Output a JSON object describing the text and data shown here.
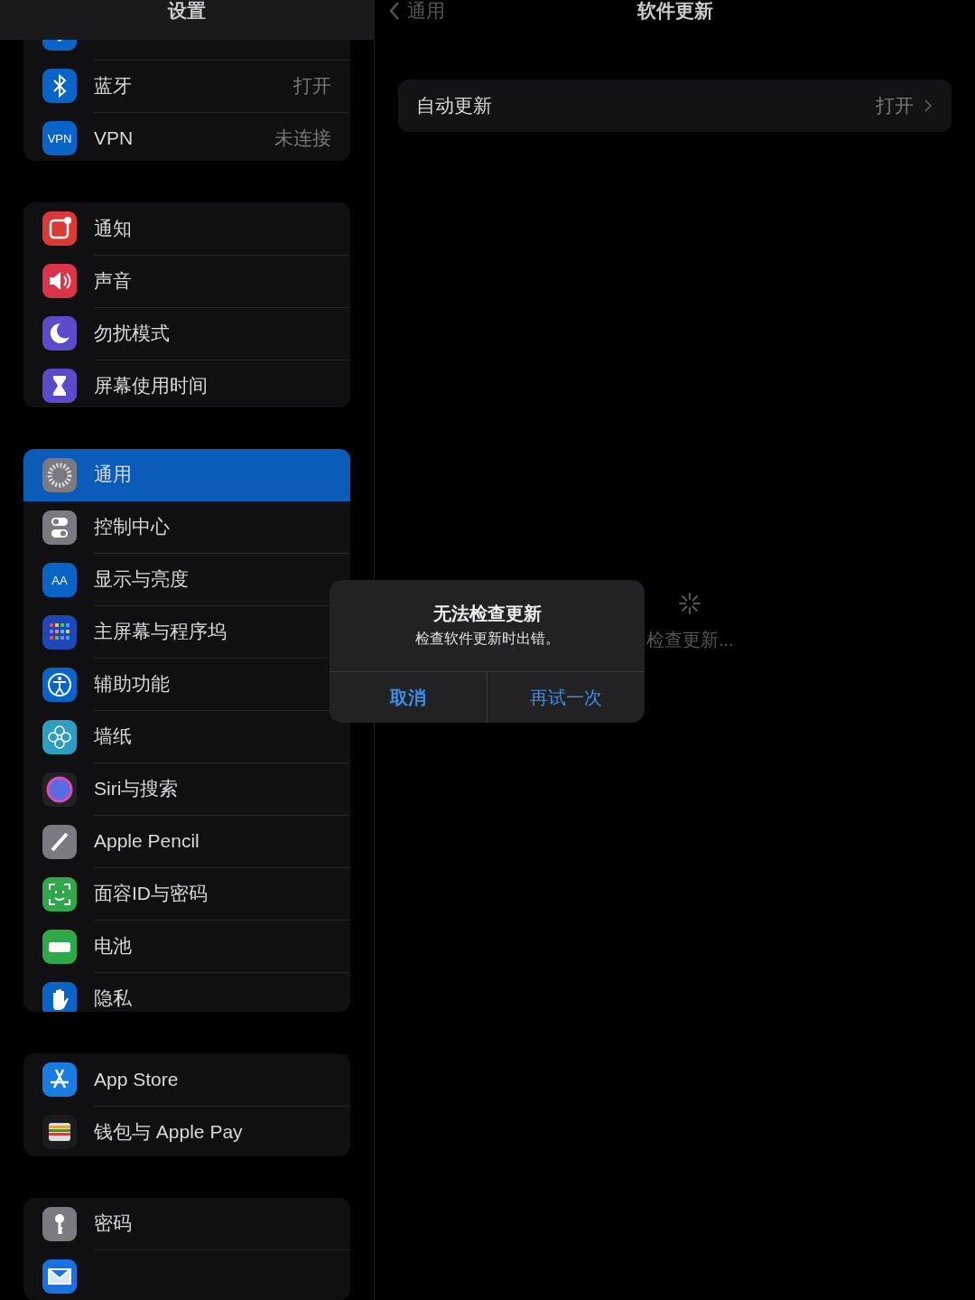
{
  "sidebar": {
    "title": "设置",
    "groups": [
      {
        "items": [
          {
            "kind": "wifi",
            "selected": false
          },
          {
            "kind": "bluetooth",
            "label": "蓝牙",
            "value": "打开",
            "selected": false
          },
          {
            "kind": "vpn",
            "icon_text": "VPN",
            "label": "VPN",
            "value": "未连接",
            "selected": false
          }
        ]
      },
      {
        "items": [
          {
            "kind": "notifications",
            "label": "通知",
            "selected": false
          },
          {
            "kind": "sound",
            "label": "声音",
            "selected": false
          },
          {
            "kind": "moon",
            "label": "勿扰模式",
            "selected": false
          },
          {
            "kind": "hourglass",
            "label": "屏幕使用时间",
            "selected": false
          }
        ]
      },
      {
        "items": [
          {
            "kind": "gear",
            "label": "通用",
            "selected": true
          },
          {
            "kind": "toggles",
            "label": "控制中心",
            "selected": false
          },
          {
            "kind": "text",
            "icon_text": "AA",
            "label": "显示与亮度",
            "selected": false
          },
          {
            "kind": "grid",
            "label": "主屏幕与程序坞",
            "selected": false
          },
          {
            "kind": "accessibility",
            "label": "辅助功能",
            "selected": false
          },
          {
            "kind": "flower",
            "label": "墙纸",
            "selected": false
          },
          {
            "kind": "orb",
            "label": "Siri与搜索",
            "selected": false
          },
          {
            "kind": "pencil",
            "label": "Apple Pencil",
            "selected": false
          },
          {
            "kind": "face",
            "label": "面容ID与密码",
            "selected": false
          },
          {
            "kind": "battery",
            "label": "电池",
            "selected": false
          },
          {
            "kind": "hand",
            "label": "隐私",
            "selected": false
          }
        ]
      },
      {
        "items": [
          {
            "kind": "appstore",
            "label": "App Store",
            "selected": false
          },
          {
            "kind": "wallet",
            "label": "钱包与 Apple Pay",
            "selected": false
          }
        ]
      },
      {
        "items": [
          {
            "kind": "key",
            "label": "密码",
            "selected": false
          },
          {
            "kind": "mail",
            "selected": false
          }
        ]
      }
    ]
  },
  "detail": {
    "back": "通用",
    "title": "软件更新",
    "rows": [
      {
        "label": "自动更新",
        "value": "打开"
      }
    ],
    "status": "检查更新..."
  },
  "dialog": {
    "title": "无法检查更新",
    "message": "检查软件更新时出错。",
    "buttons": [
      {
        "label": "取消",
        "kind": "cancel"
      },
      {
        "label": "再试一次",
        "kind": "retry"
      }
    ]
  }
}
